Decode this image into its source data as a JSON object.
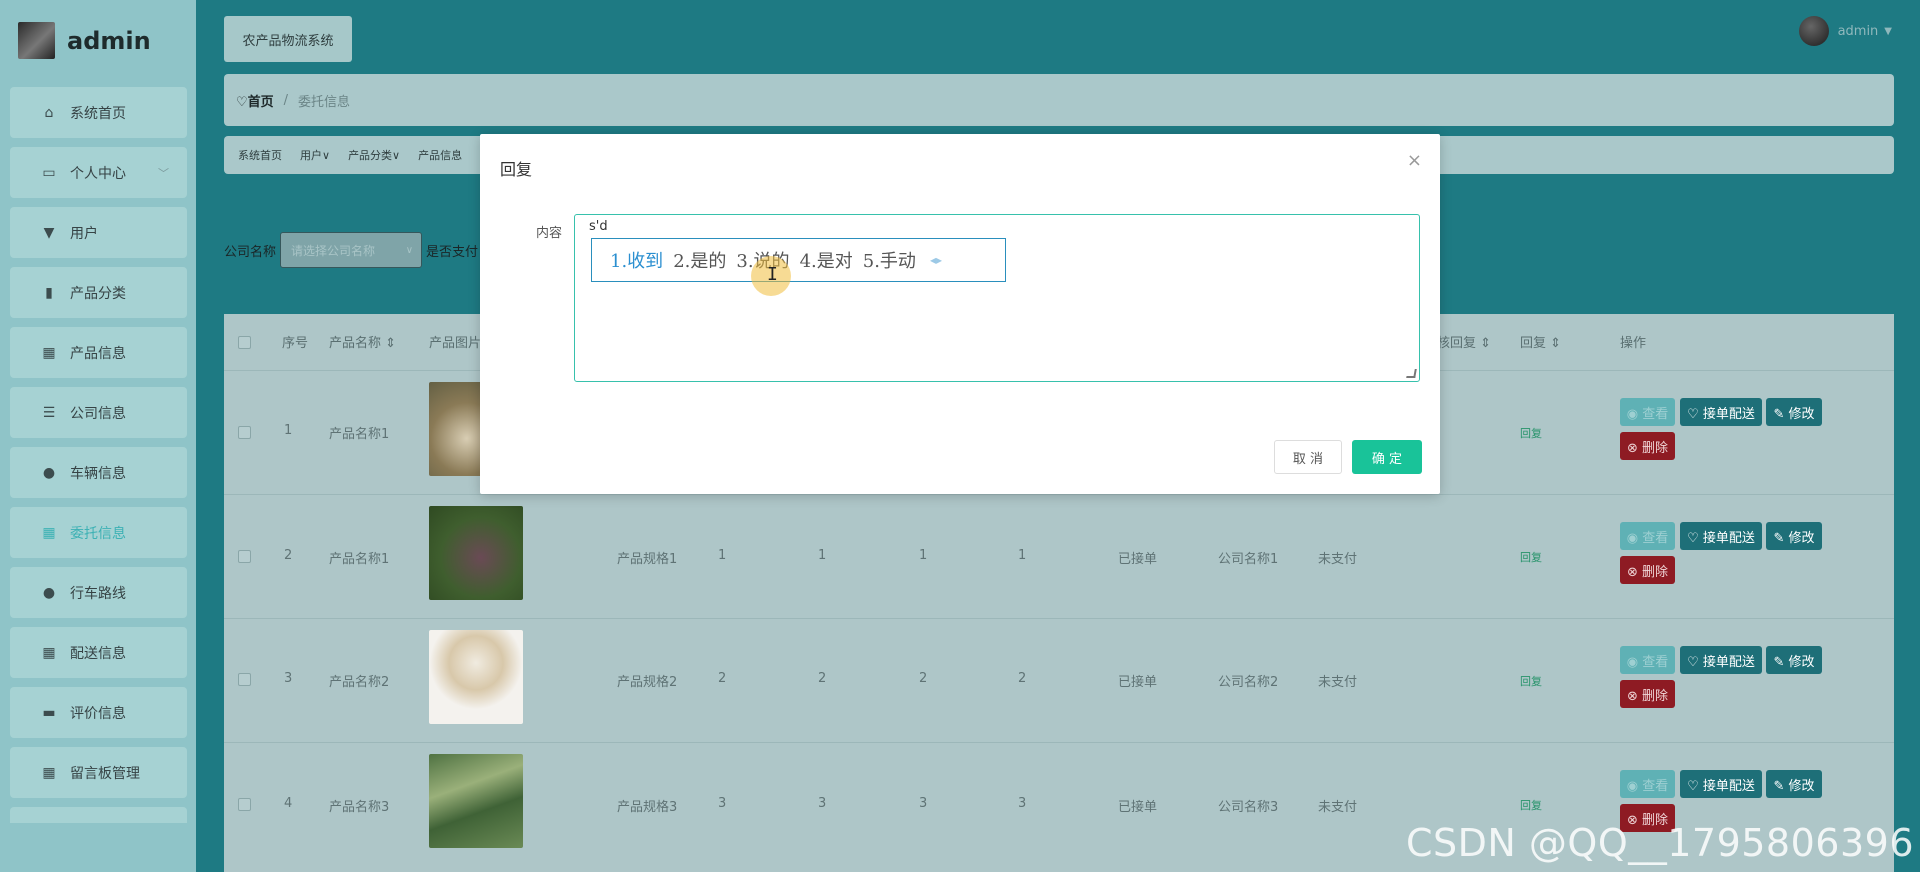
{
  "sidebar": {
    "username": "admin",
    "items": [
      {
        "label": "系统首页",
        "icon": "home-icon",
        "glyph": "⌂"
      },
      {
        "label": "个人中心",
        "icon": "id-card-icon",
        "glyph": "▭",
        "chevron": "﹀"
      },
      {
        "label": "用户",
        "icon": "user-icon",
        "glyph": "▼"
      },
      {
        "label": "产品分类",
        "icon": "bar-chart-icon",
        "glyph": "▮"
      },
      {
        "label": "产品信息",
        "icon": "grid-icon",
        "glyph": "▦"
      },
      {
        "label": "公司信息",
        "icon": "sliders-icon",
        "glyph": "☰"
      },
      {
        "label": "车辆信息",
        "icon": "person-icon",
        "glyph": "●"
      },
      {
        "label": "委托信息",
        "icon": "grid-icon",
        "glyph": "▦"
      },
      {
        "label": "行车路线",
        "icon": "location-pin-icon",
        "glyph": "●"
      },
      {
        "label": "配送信息",
        "icon": "grid-icon",
        "glyph": "▦"
      },
      {
        "label": "评价信息",
        "icon": "comment-icon",
        "glyph": "▬"
      },
      {
        "label": "留言板管理",
        "icon": "grid-icon",
        "glyph": "▦"
      }
    ]
  },
  "header": {
    "system_title": "农产品物流系统",
    "user": "admin",
    "user_caret": "▼"
  },
  "breadcrumb": {
    "home": "♡首页",
    "separator": "/",
    "current": "委托信息"
  },
  "tabs": [
    "系统首页",
    "用户∨",
    "产品分类∨",
    "产品信息"
  ],
  "search": {
    "company_label": "公司名称",
    "company_placeholder": "请选择公司名称",
    "dropdown_icon": "∨",
    "pay_label": "是否支付"
  },
  "table": {
    "headers": [
      "序号",
      "产品名称 ⇕",
      "产品图片",
      "审核回复 ⇕",
      "回复 ⇕",
      "操作"
    ],
    "rows": [
      {
        "index": "1",
        "name": "产品名称1",
        "spec": "",
        "q1": "",
        "q2": "",
        "q3": "",
        "q4": "",
        "status": "",
        "company": "",
        "paid": "",
        "reply": "回复"
      },
      {
        "index": "2",
        "name": "产品名称1",
        "spec": "产品规格1",
        "q1": "1",
        "q2": "1",
        "q3": "1",
        "q4": "1",
        "status": "已接单",
        "company": "公司名称1",
        "paid": "未支付",
        "reply": "回复"
      },
      {
        "index": "3",
        "name": "产品名称2",
        "spec": "产品规格2",
        "q1": "2",
        "q2": "2",
        "q3": "2",
        "q4": "2",
        "status": "已接单",
        "company": "公司名称2",
        "paid": "未支付",
        "reply": "回复"
      },
      {
        "index": "4",
        "name": "产品名称3",
        "spec": "产品规格3",
        "q1": "3",
        "q2": "3",
        "q3": "3",
        "q4": "3",
        "status": "已接单",
        "company": "公司名称3",
        "paid": "未支付",
        "reply": "回复"
      }
    ],
    "actions": {
      "view": "◉ 查看",
      "accept": "♡ 接单配送",
      "edit": "✎ 修改",
      "delete": "⊗ 删除"
    }
  },
  "dialog": {
    "title": "回复",
    "close": "×",
    "content_label": "内容",
    "content_value": "s'd",
    "ime_candidates": [
      "1.收到",
      "2.是的",
      "3.说的",
      "4.是对",
      "5.手动"
    ],
    "ime_arrows": "◂▸",
    "cursor_glyph": "I",
    "cancel": "取 消",
    "confirm": "确 定"
  },
  "watermark": "CSDN @QQ__1795806396",
  "colors": {
    "sidebar": "#8fc4c8",
    "main": "#1e7a83",
    "accent": "#19c399",
    "active": "#3cb1b4",
    "danger": "#8e1b23"
  }
}
